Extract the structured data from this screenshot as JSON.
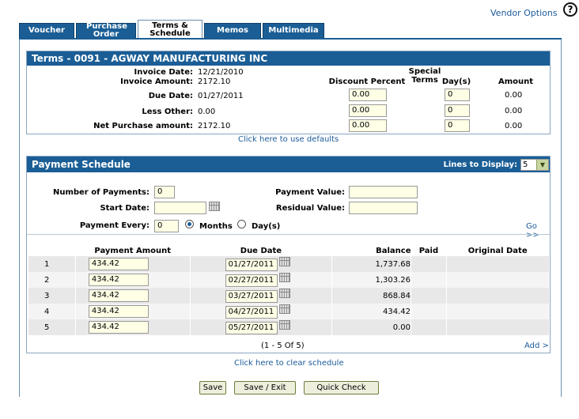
{
  "header": {
    "vendor_options": "Vendor Options",
    "help": "?"
  },
  "tabs": [
    {
      "label": "Voucher"
    },
    {
      "label": "Purchase Order"
    },
    {
      "label": "Terms & Schedule"
    },
    {
      "label": "Memos"
    },
    {
      "label": "Multimedia"
    }
  ],
  "terms": {
    "title": "Terms -  0091 - AGWAY MANUFACTURING INC",
    "invoice_date_label": "Invoice Date:",
    "invoice_date": "12/21/2010",
    "invoice_amount_label": "Invoice Amount:",
    "invoice_amount": "2172.10",
    "due_date_label": "Due Date:",
    "due_date": "01/27/2011",
    "less_other_label": "Less Other:",
    "less_other": "0.00",
    "net_purchase_label": "Net Purchase amount:",
    "net_purchase": "2172.10",
    "special_terms_label": "Special Terms",
    "discount_percent_label": "Discount Percent",
    "days_label": "Day(s)",
    "amount_label": "Amount",
    "rows": [
      {
        "discount": "0.00",
        "days": "0",
        "amount": "0.00"
      },
      {
        "discount": "0.00",
        "days": "0",
        "amount": "0.00"
      },
      {
        "discount": "0.00",
        "days": "0",
        "amount": "0.00"
      }
    ],
    "defaults_link": "Click here to use defaults"
  },
  "schedule": {
    "title": "Payment Schedule",
    "lines_label": "Lines to Display:",
    "lines_value": "5",
    "num_payments_label": "Number of Payments:",
    "num_payments": "0",
    "start_date_label": "Start Date:",
    "start_date": "",
    "payment_every_label": "Payment Every:",
    "payment_every": "0",
    "months_label": "Months",
    "days_label": "Day(s)",
    "payment_value_label": "Payment Value:",
    "payment_value": "",
    "residual_value_label": "Residual Value:",
    "residual_value": "",
    "go_link": "Go >>",
    "col_payment_amount": "Payment Amount",
    "col_due_date": "Due Date",
    "col_balance": "Balance",
    "col_paid": "Paid",
    "col_original_date": "Original Date",
    "rows": [
      {
        "num": "1",
        "amount": "434.42",
        "due": "01/27/2011",
        "balance": "1,737.68"
      },
      {
        "num": "2",
        "amount": "434.42",
        "due": "02/27/2011",
        "balance": "1,303.26"
      },
      {
        "num": "3",
        "amount": "434.42",
        "due": "03/27/2011",
        "balance": "868.84"
      },
      {
        "num": "4",
        "amount": "434.42",
        "due": "04/27/2011",
        "balance": "434.42"
      },
      {
        "num": "5",
        "amount": "434.42",
        "due": "05/27/2011",
        "balance": "0.00"
      }
    ],
    "pager": "(1 - 5 Of 5)",
    "add_link": "Add >",
    "clear_link": "Click here to clear schedule"
  },
  "buttons": {
    "save": "Save",
    "save_exit": "Save / Exit",
    "quick_check": "Quick Check"
  }
}
